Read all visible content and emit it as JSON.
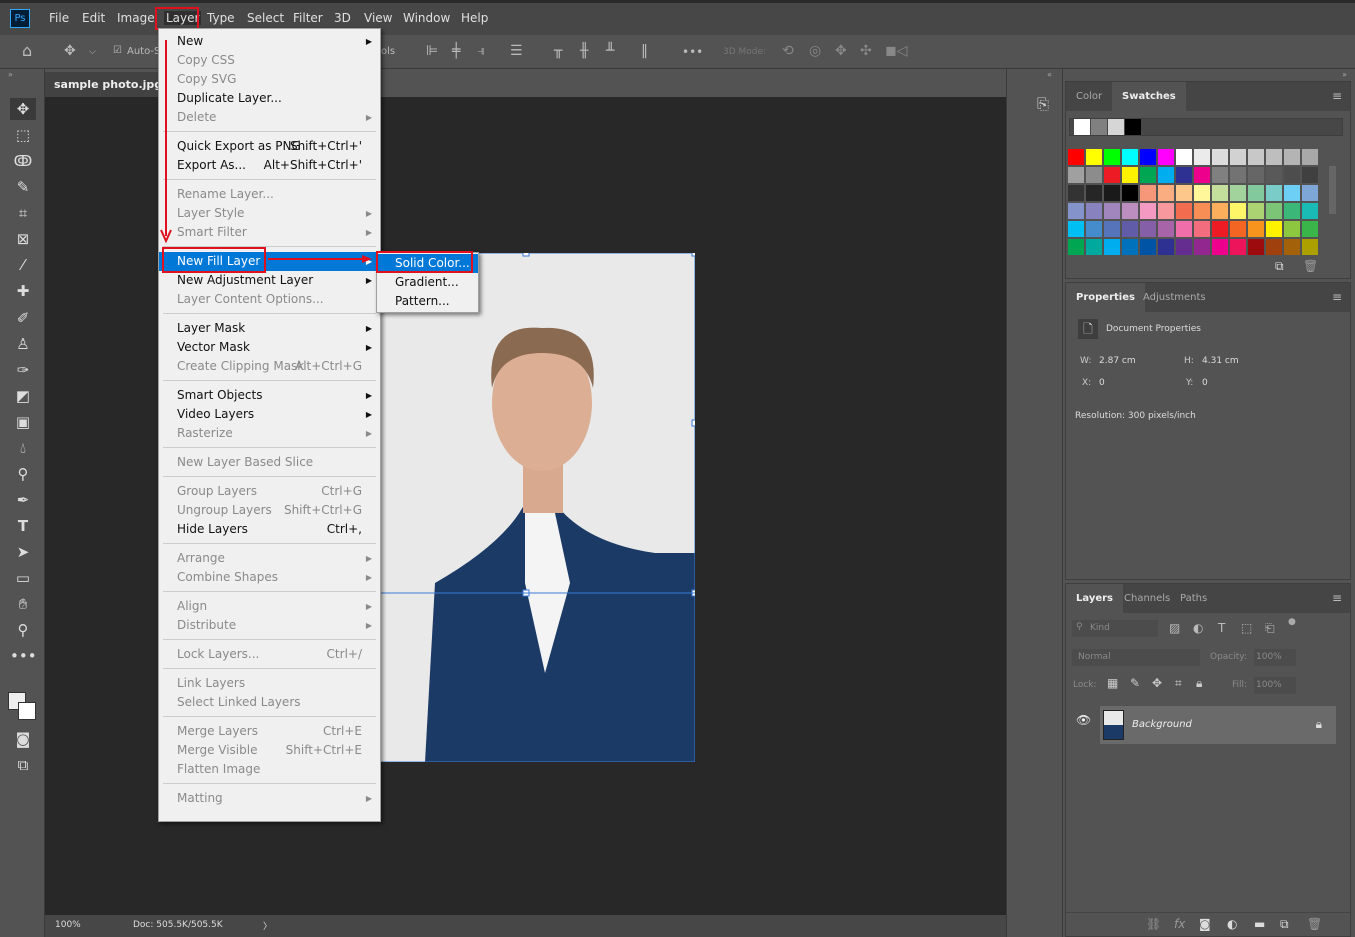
{
  "app": {
    "logo": "Ps",
    "accent": "#31a8ff"
  },
  "menubar": {
    "items": [
      "File",
      "Edit",
      "Image",
      "Layer",
      "Type",
      "Select",
      "Filter",
      "3D",
      "View",
      "Window",
      "Help"
    ],
    "active": "Layer"
  },
  "options_bar": {
    "home_icon": "home-icon",
    "move_icon": "move-icon",
    "auto_select_label": "Auto-S",
    "controls_label": "ols",
    "more_label": "•••",
    "mode_label": "3D Mode:"
  },
  "document": {
    "tab_title": "sample photo.jpg @",
    "zoom": "100%",
    "doc_info": "Doc: 505.5K/505.5K",
    "status_arrow": "〉"
  },
  "layer_menu": {
    "items": [
      {
        "label": "New",
        "enabled": true,
        "submenu": true
      },
      {
        "label": "Copy CSS",
        "enabled": false
      },
      {
        "label": "Copy SVG",
        "enabled": false
      },
      {
        "label": "Duplicate Layer...",
        "enabled": true
      },
      {
        "label": "Delete",
        "enabled": false,
        "submenu": true
      },
      {
        "sep": true
      },
      {
        "label": "Quick Export as PNG",
        "shortcut": "Shift+Ctrl+'",
        "enabled": true
      },
      {
        "label": "Export As...",
        "shortcut": "Alt+Shift+Ctrl+'",
        "enabled": true
      },
      {
        "sep": true
      },
      {
        "label": "Rename Layer...",
        "enabled": false
      },
      {
        "label": "Layer Style",
        "enabled": false,
        "submenu": true
      },
      {
        "label": "Smart Filter",
        "enabled": false,
        "submenu": true
      },
      {
        "sep": true
      },
      {
        "label": "New Fill Layer",
        "enabled": true,
        "submenu": true,
        "highlighted": true
      },
      {
        "label": "New Adjustment Layer",
        "enabled": true,
        "submenu": true
      },
      {
        "label": "Layer Content Options...",
        "enabled": false
      },
      {
        "sep": true
      },
      {
        "label": "Layer Mask",
        "enabled": true,
        "submenu": true
      },
      {
        "label": "Vector Mask",
        "enabled": true,
        "submenu": true
      },
      {
        "label": "Create Clipping Mask",
        "shortcut": "Alt+Ctrl+G",
        "enabled": false
      },
      {
        "sep": true
      },
      {
        "label": "Smart Objects",
        "enabled": true,
        "submenu": true
      },
      {
        "label": "Video Layers",
        "enabled": true,
        "submenu": true
      },
      {
        "label": "Rasterize",
        "enabled": false,
        "submenu": true
      },
      {
        "sep": true
      },
      {
        "label": "New Layer Based Slice",
        "enabled": false
      },
      {
        "sep": true
      },
      {
        "label": "Group Layers",
        "shortcut": "Ctrl+G",
        "enabled": false
      },
      {
        "label": "Ungroup Layers",
        "shortcut": "Shift+Ctrl+G",
        "enabled": false
      },
      {
        "label": "Hide Layers",
        "shortcut": "Ctrl+,",
        "enabled": true
      },
      {
        "sep": true
      },
      {
        "label": "Arrange",
        "enabled": false,
        "submenu": true
      },
      {
        "label": "Combine Shapes",
        "enabled": false,
        "submenu": true
      },
      {
        "sep": true
      },
      {
        "label": "Align",
        "enabled": false,
        "submenu": true
      },
      {
        "label": "Distribute",
        "enabled": false,
        "submenu": true
      },
      {
        "sep": true
      },
      {
        "label": "Lock Layers...",
        "shortcut": "Ctrl+/",
        "enabled": false
      },
      {
        "sep": true
      },
      {
        "label": "Link Layers",
        "enabled": false
      },
      {
        "label": "Select Linked Layers",
        "enabled": false
      },
      {
        "sep": true
      },
      {
        "label": "Merge Layers",
        "shortcut": "Ctrl+E",
        "enabled": false
      },
      {
        "label": "Merge Visible",
        "shortcut": "Shift+Ctrl+E",
        "enabled": false
      },
      {
        "label": "Flatten Image",
        "enabled": false
      },
      {
        "sep": true
      },
      {
        "label": "Matting",
        "enabled": false,
        "submenu": true
      }
    ]
  },
  "fill_submenu": {
    "items": [
      {
        "label": "Solid Color...",
        "highlighted": true
      },
      {
        "label": "Gradient..."
      },
      {
        "label": "Pattern..."
      }
    ]
  },
  "annotation_color": "#e0101e",
  "swatches_panel": {
    "tabs": [
      "Color",
      "Swatches"
    ],
    "active_tab": "Swatches",
    "recent": [
      "#ffffff",
      "#808080",
      "#d6d6d6",
      "#000000"
    ],
    "grid": [
      [
        "#ff0000",
        "#ffff00",
        "#00ff00",
        "#00ffff",
        "#0000ff",
        "#ff00ff",
        "#ffffff",
        "#ebebeb",
        "#dcdcdc",
        "#d2d2d2",
        "#c8c8c8",
        "#bebebe",
        "#b4b4b4",
        "#a8a8a8"
      ],
      [
        "#a0a0a0",
        "#8c8c8c",
        "#ed1c24",
        "#fff200",
        "#00a651",
        "#00aeef",
        "#2e3192",
        "#ec008c",
        "#808080",
        "#737373",
        "#666666",
        "#595959",
        "#4d4d4d",
        "#404040"
      ],
      [
        "#333333",
        "#262626",
        "#1a1a1a",
        "#000000",
        "#f7977a",
        "#f9ad81",
        "#fdc68a",
        "#fff79a",
        "#c4df9b",
        "#a3d39c",
        "#82ca9d",
        "#7accc8",
        "#6dcff6",
        "#7ea7d8"
      ],
      [
        "#8493ca",
        "#8882be",
        "#a186be",
        "#bc8dbf",
        "#f49ac2",
        "#f6989d",
        "#f26c4f",
        "#f68e56",
        "#fbaf5d",
        "#fff568",
        "#acd372",
        "#7cc576",
        "#3bb878",
        "#1abbb4"
      ],
      [
        "#00bff3",
        "#448ccb",
        "#5674b9",
        "#605ca8",
        "#8560a8",
        "#a864a8",
        "#f06eaa",
        "#f26d7d",
        "#ed1c24",
        "#f26522",
        "#f7941d",
        "#fff200",
        "#8dc63f",
        "#39b54a"
      ],
      [
        "#00a651",
        "#00a99d",
        "#00aeef",
        "#0072bc",
        "#0054a6",
        "#2e3192",
        "#662d91",
        "#92278f",
        "#ec008c",
        "#ed145b",
        "#9e0b0f",
        "#a0410d",
        "#a36209",
        "#aba000"
      ]
    ]
  },
  "properties_panel": {
    "tabs": [
      "Properties",
      "Adjustments"
    ],
    "active_tab": "Properties",
    "section": "Document Properties",
    "w_label": "W:",
    "w": "2.87 cm",
    "h_label": "H:",
    "h": "4.31 cm",
    "x_label": "X:",
    "x": "0",
    "y_label": "Y:",
    "y": "0",
    "resolution": "Resolution: 300 pixels/inch"
  },
  "layers_panel": {
    "tabs": [
      "Layers",
      "Channels",
      "Paths"
    ],
    "active_tab": "Layers",
    "filter_placeholder": "Kind",
    "blend_mode": "Normal",
    "opacity_label": "Opacity:",
    "opacity": "100%",
    "lock_label": "Lock:",
    "fill_label": "Fill:",
    "fill": "100%",
    "layers": [
      {
        "name": "Background",
        "visible": true,
        "locked": true
      }
    ]
  }
}
